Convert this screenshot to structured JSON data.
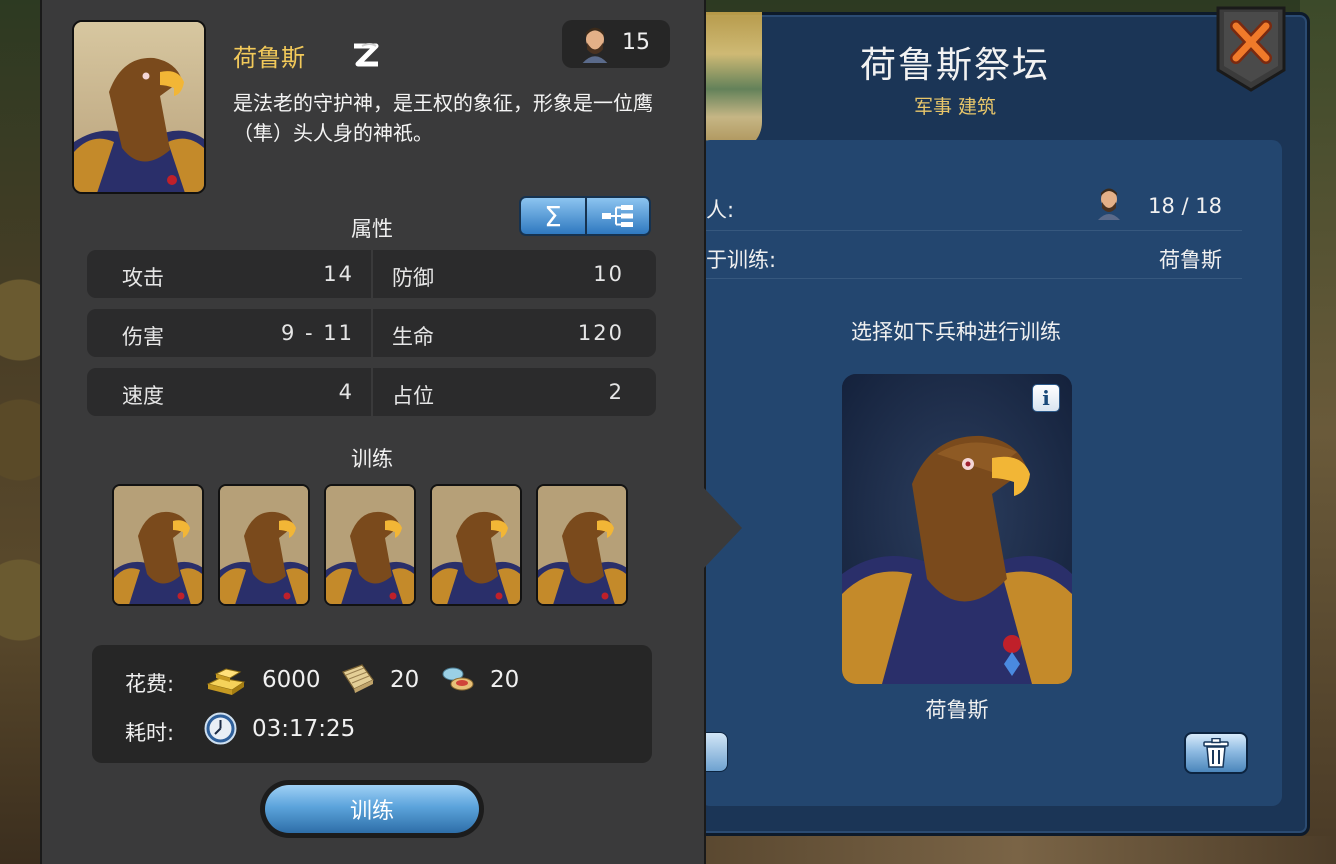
{
  "unit_detail": {
    "name": "荷鲁斯",
    "tier_icon": "tier-2-badge",
    "population_cost": "15",
    "description": "是法老的守护神，是王权的象征，形象是一位鹰（隼）头人身的神祇。",
    "attributes_title": "属性",
    "toggle": {
      "sum_symbol": "Σ",
      "tree_icon": "tree-icon"
    },
    "stats": [
      {
        "label": "攻击",
        "value": "14"
      },
      {
        "label": "防御",
        "value": "10"
      },
      {
        "label": "伤害",
        "value": "9 - 11"
      },
      {
        "label": "生命",
        "value": "120"
      },
      {
        "label": "速度",
        "value": "4"
      },
      {
        "label": "占位",
        "value": "2"
      }
    ],
    "training_title": "训练",
    "training_slots": 5,
    "cost": {
      "cost_label": "花费:",
      "gold": "6000",
      "papyrus": "20",
      "gems": "20",
      "time_label": "耗时:",
      "time": "03:17:25"
    },
    "train_button": "训练"
  },
  "altar": {
    "title": "荷鲁斯祭坛",
    "subtitle": "军事  建筑",
    "rows": [
      {
        "label": "人:",
        "value": "18 / 18"
      },
      {
        "label": "于训练:",
        "value": "荷鲁斯"
      }
    ],
    "choose_text": "选择如下兵种进行训练",
    "unit_card_name": "荷鲁斯",
    "info_icon": "i"
  },
  "colors": {
    "title_gold": "#f2c95a",
    "panel_blue": "#1b3556",
    "button_blue": "#5ca4dc"
  }
}
